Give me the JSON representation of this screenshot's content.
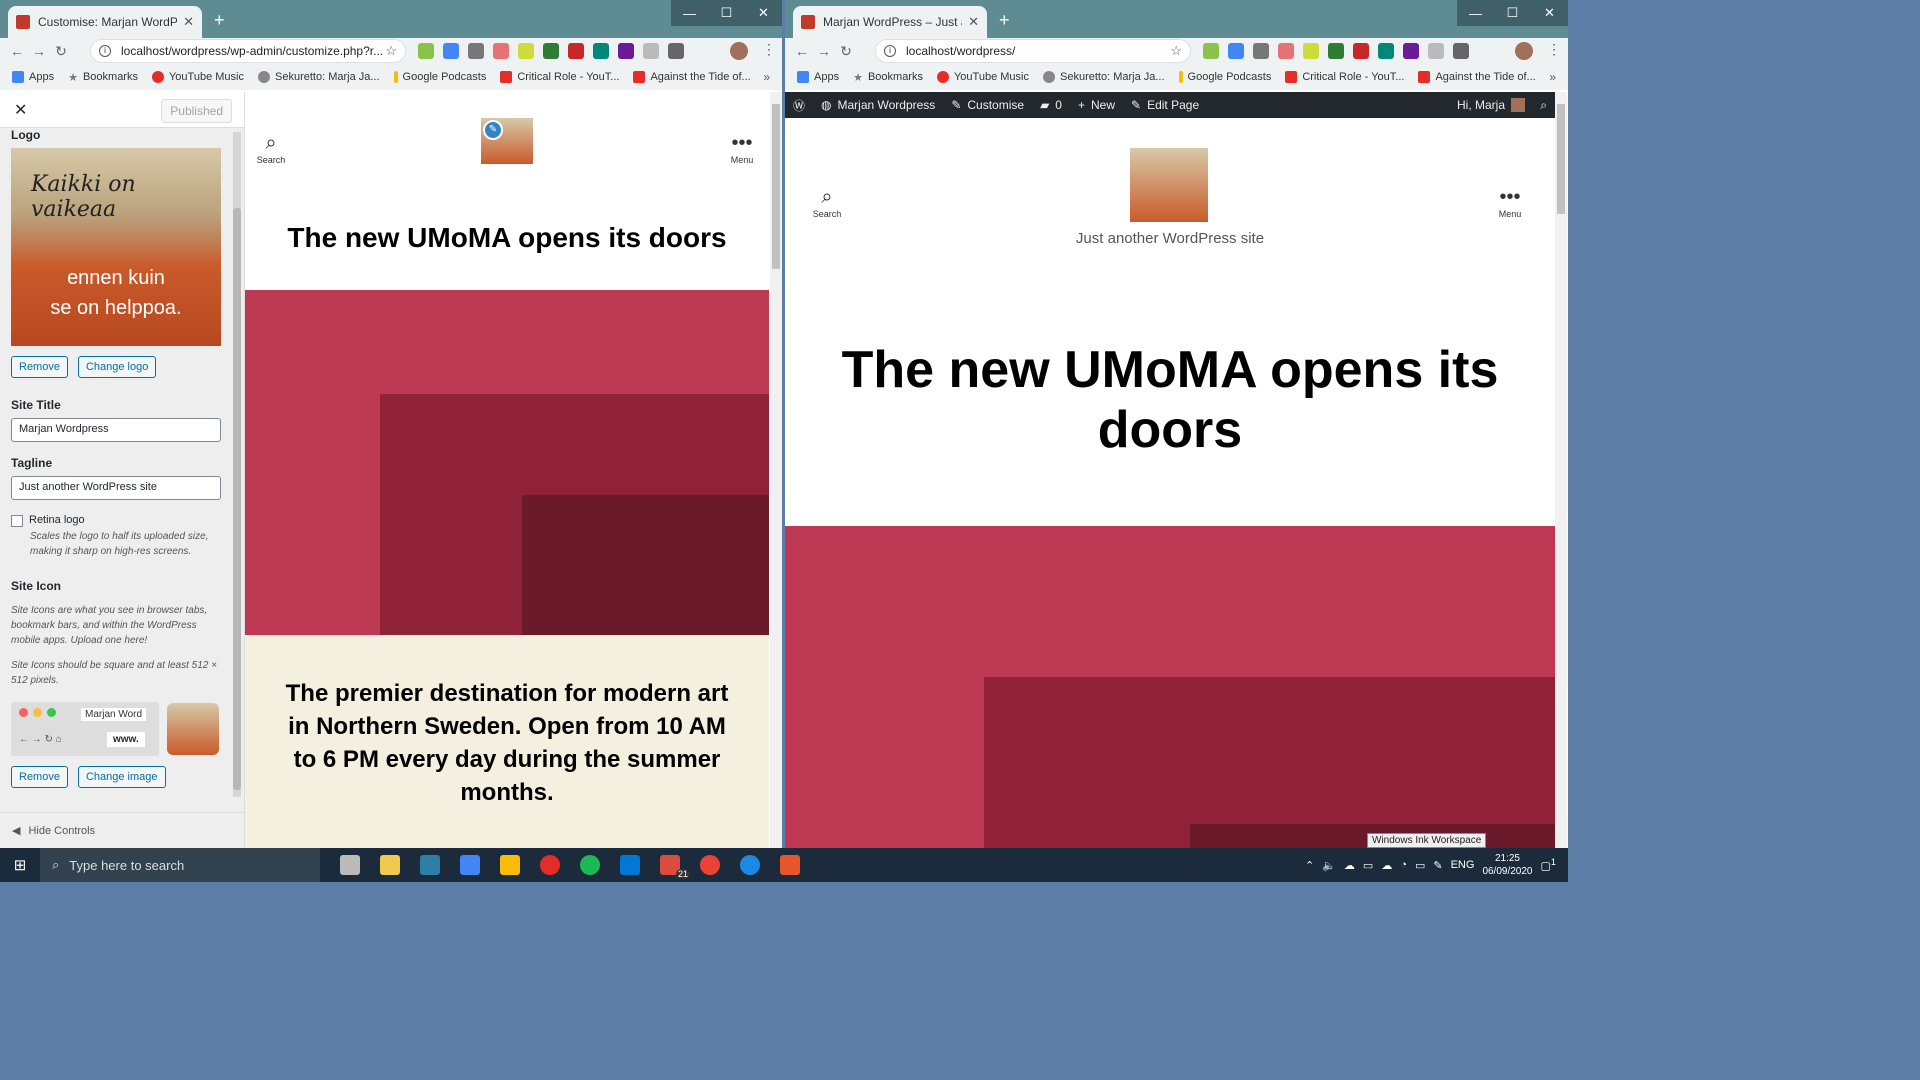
{
  "left_window": {
    "tab_title": "Customise: Marjan WordPress –",
    "url": "localhost/wordpress/wp-admin/customize.php?r...",
    "bookmarks": [
      "Apps",
      "Bookmarks",
      "YouTube Music",
      "Sekuretto: Marja Ja...",
      "Google Podcasts",
      "Critical Role - YouT...",
      "Against the Tide of..."
    ],
    "customizer": {
      "published_label": "Published",
      "logo_heading": "Logo",
      "logo_text_top": "Kaikki on vaikeaa",
      "logo_text_bottom_1": "ennen kuin",
      "logo_text_bottom_2": "se on helppoa.",
      "remove_label": "Remove",
      "change_logo_label": "Change logo",
      "site_title_heading": "Site Title",
      "site_title_value": "Marjan Wordpress",
      "tagline_heading": "Tagline",
      "tagline_value": "Just another WordPress site",
      "retina_label": "Retina logo",
      "retina_desc": "Scales the logo to half its uploaded size, making it sharp on high-res screens.",
      "site_icon_heading": "Site Icon",
      "site_icon_para1": "Site Icons are what you see in browser tabs, bookmark bars, and within the WordPress mobile apps. Upload one here!",
      "site_icon_para2": "Site Icons should be square and at least 512 × 512 pixels.",
      "mini_tab_text": "Marjan Word",
      "mini_url": "www.",
      "remove2_label": "Remove",
      "change_image_label": "Change image",
      "hide_controls_label": "Hide Controls"
    },
    "preview": {
      "search_label": "Search",
      "menu_label": "Menu",
      "page_title": "The new UMoMA opens its doors",
      "intro_text": "The premier destination for modern art in Northern Sweden. Open from 10 AM to 6 PM every day during the summer months."
    }
  },
  "right_window": {
    "tab_title": "Marjan WordPress – Just another",
    "url": "localhost/wordpress/",
    "bookmarks": [
      "Apps",
      "Bookmarks",
      "YouTube Music",
      "Sekuretto: Marja Ja...",
      "Google Podcasts",
      "Critical Role - YouT...",
      "Against the Tide of..."
    ],
    "adminbar": {
      "site_name": "Marjan Wordpress",
      "customise": "Customise",
      "comments": "0",
      "new": "New",
      "edit_page": "Edit Page",
      "greeting": "Hi, Marja"
    },
    "page": {
      "search_label": "Search",
      "menu_label": "Menu",
      "tagline": "Just another WordPress site",
      "title": "The new UMoMA opens its doors"
    }
  },
  "taskbar": {
    "search_placeholder": "Type here to search",
    "badge_count": "21",
    "lang": "ENG",
    "time": "21:25",
    "date": "06/09/2020",
    "tooltip": "Windows Ink Workspace",
    "notification_count": "1"
  },
  "colors": {
    "accent_red": "#bd3853",
    "dark_red": "#8f2238",
    "darker_red": "#6b1a2b",
    "beige": "#f5efe0",
    "admin_bar": "#23282d",
    "wp_blue": "#0071a1"
  }
}
